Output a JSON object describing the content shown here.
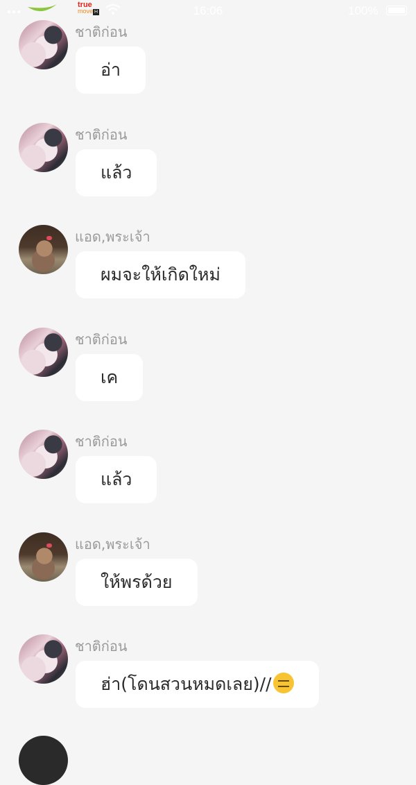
{
  "status_bar": {
    "carrier": "true",
    "carrier_sub": "move",
    "carrier_badge": "H",
    "time": "16:06",
    "battery": "100%",
    "battery_level": 1.0
  },
  "messages": [
    {
      "sender": "ชาติก่อน",
      "avatar": "girl-avatar",
      "text": "อ่า"
    },
    {
      "sender": "ชาติก่อน",
      "avatar": "girl-avatar",
      "text": "แล้ว"
    },
    {
      "sender": "แอด,พระเจ้า",
      "avatar": "cat-avatar",
      "text": "ผมจะให้เกิดใหม่"
    },
    {
      "sender": "ชาติก่อน",
      "avatar": "girl-avatar",
      "text": "เค"
    },
    {
      "sender": "ชาติก่อน",
      "avatar": "girl-avatar",
      "text": "แล้ว"
    },
    {
      "sender": "แอด,พระเจ้า",
      "avatar": "cat-avatar",
      "text": "ให้พรด้วย"
    },
    {
      "sender": "ชาติก่อน",
      "avatar": "girl-avatar",
      "text": "ฮ่า(โดนสวนหมดเลย)//",
      "emoji": "expressionless-face-icon"
    }
  ]
}
